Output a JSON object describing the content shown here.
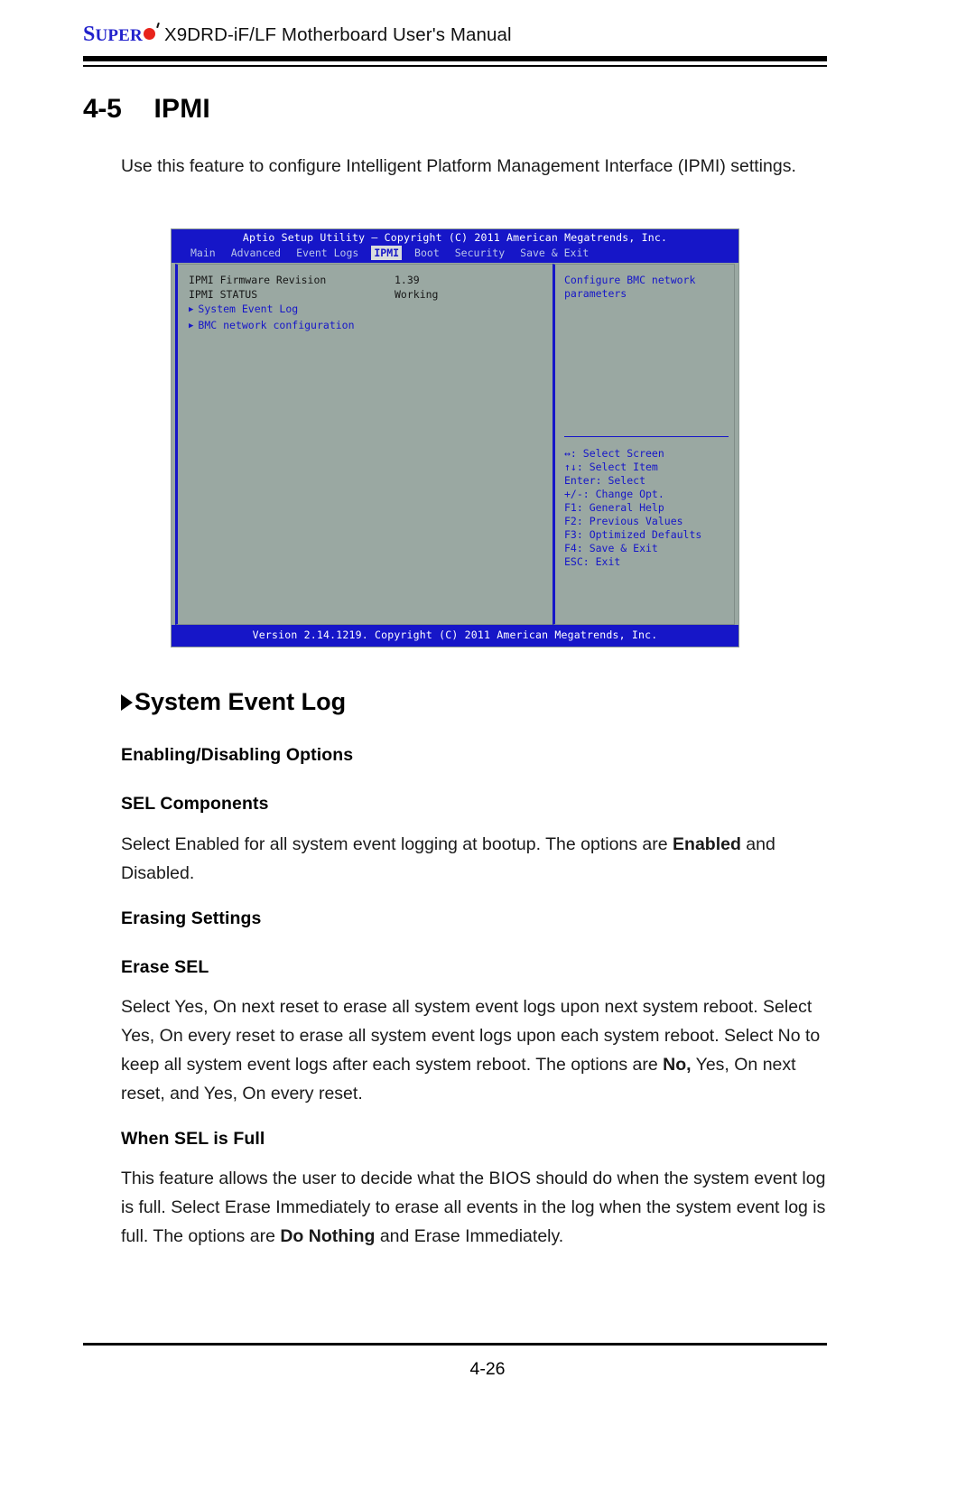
{
  "header": {
    "brand_s": "S",
    "brand_rest": "UPER",
    "title": "X9DRD-iF/LF Motherboard User's Manual"
  },
  "section": {
    "number": "4-5",
    "title": "IPMI",
    "intro": "Use this feature to configure Intelligent Platform Management Interface (IPMI) settings."
  },
  "bios": {
    "title": "Aptio Setup Utility – Copyright (C) 2011 American Megatrends, Inc.",
    "menu": [
      {
        "label": "Main",
        "active": false
      },
      {
        "label": "Advanced",
        "active": false
      },
      {
        "label": "Event Logs",
        "active": false
      },
      {
        "label": "IPMI",
        "active": true
      },
      {
        "label": "Boot",
        "active": false
      },
      {
        "label": "Security",
        "active": false
      },
      {
        "label": "Save & Exit",
        "active": false
      }
    ],
    "items": [
      {
        "label": "IPMI Firmware Revision",
        "value": "1.39"
      },
      {
        "label": "IPMI STATUS",
        "value": "Working"
      }
    ],
    "submenus": [
      {
        "label": "System Event Log"
      },
      {
        "label": "BMC network configuration"
      }
    ],
    "help": "Configure BMC network parameters",
    "keys": [
      "↔: Select Screen",
      "↑↓: Select Item",
      "Enter: Select",
      "+/-: Change Opt.",
      "F1: General Help",
      "F2: Previous Values",
      "F3: Optimized Defaults",
      "F4: Save & Exit",
      "ESC: Exit"
    ],
    "footer": "Version 2.14.1219. Copyright (C) 2011 American Megatrends, Inc."
  },
  "content": {
    "system_event_log_heading": "System Event Log",
    "enabling_disabling_heading": "Enabling/Disabling Options",
    "sel_components_heading": "SEL Components",
    "sel_components_text_1": "Select Enabled for all system event logging at bootup. The options are ",
    "sel_components_bold_1": "Enabled",
    "sel_components_text_2": " and Disabled.",
    "erasing_settings_heading": "Erasing Settings",
    "erase_sel_heading": "Erase SEL",
    "erase_sel_text_1": "Select Yes, On next reset to erase all system event logs upon next system reboot. Select Yes, On every reset to erase all system event logs upon each system reboot. Select No to keep all system event logs after each system reboot. The options are ",
    "erase_sel_bold_1": "No,",
    "erase_sel_text_2": " Yes, On next reset, and Yes, On every reset.",
    "when_sel_full_heading": "When SEL is Full",
    "when_sel_full_text_1": "This feature allows the user to decide what the BIOS should do when the system event log is full. Select Erase Immediately to erase all events in the log when the system event log is full. The options are ",
    "when_sel_full_bold_1": "Do Nothing",
    "when_sel_full_text_2": " and Erase Immediately."
  },
  "footer": {
    "page_number": "4-26"
  },
  "colors": {
    "brand_blue": "#2222cc",
    "brand_red": "#e8241c",
    "bios_blue": "#1616c8",
    "bios_bg": "#9aa8a2"
  }
}
